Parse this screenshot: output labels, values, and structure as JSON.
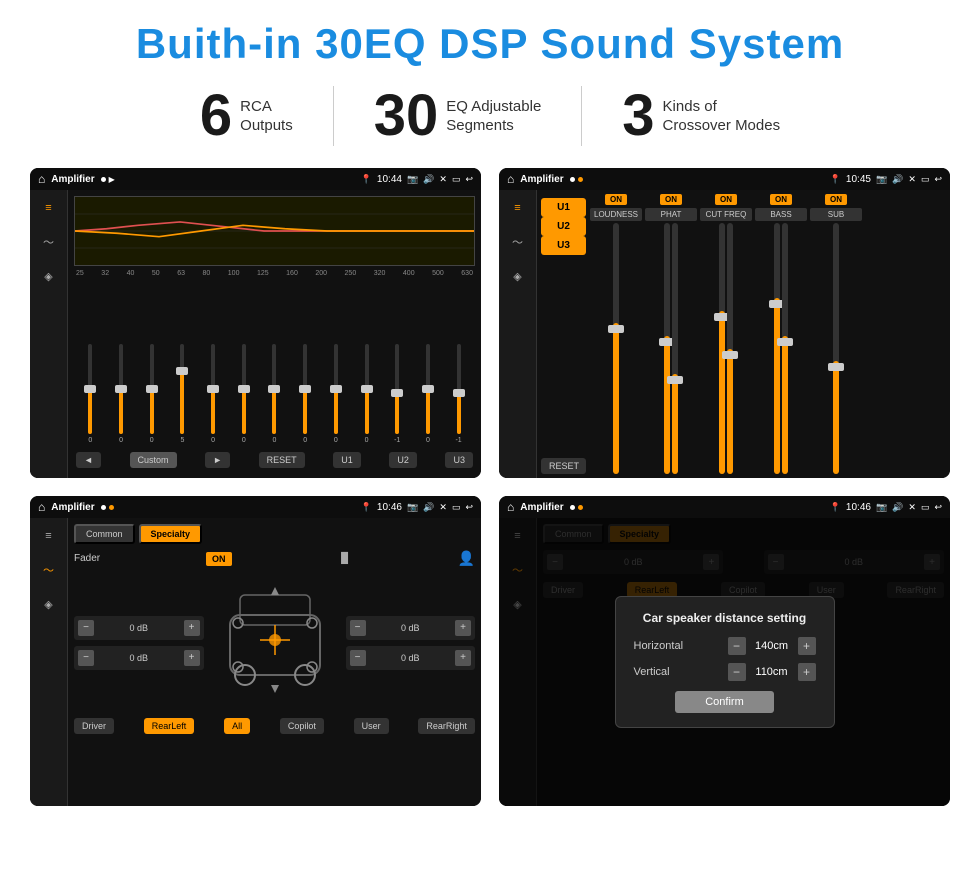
{
  "header": {
    "title": "Buith-in 30EQ DSP Sound System"
  },
  "stats": [
    {
      "number": "6",
      "label": "RCA\nOutputs"
    },
    {
      "number": "30",
      "label": "EQ Adjustable\nSegments"
    },
    {
      "number": "3",
      "label": "Kinds of\nCrossover Modes"
    }
  ],
  "screens": [
    {
      "id": "screen1",
      "statusbar": {
        "app": "Amplifier",
        "time": "10:44"
      },
      "type": "eq",
      "freqs": [
        "25",
        "32",
        "40",
        "50",
        "63",
        "80",
        "100",
        "125",
        "160",
        "200",
        "250",
        "320",
        "400",
        "500",
        "630"
      ],
      "values": [
        "0",
        "0",
        "0",
        "5",
        "0",
        "0",
        "0",
        "0",
        "0",
        "0",
        "-1",
        "0",
        "-1"
      ],
      "preset": "Custom",
      "buttons": [
        "◄",
        "Custom",
        "►",
        "RESET",
        "U1",
        "U2",
        "U3"
      ]
    },
    {
      "id": "screen2",
      "statusbar": {
        "app": "Amplifier",
        "time": "10:45"
      },
      "type": "crossover",
      "u_buttons": [
        "U1",
        "U2",
        "U3"
      ],
      "channels": [
        {
          "label": "LOUDNESS",
          "on": true
        },
        {
          "label": "PHAT",
          "on": true
        },
        {
          "label": "CUT FREQ",
          "on": true
        },
        {
          "label": "BASS",
          "on": true
        },
        {
          "label": "SUB",
          "on": true
        }
      ],
      "reset_label": "RESET"
    },
    {
      "id": "screen3",
      "statusbar": {
        "app": "Amplifier",
        "time": "10:46"
      },
      "type": "fader",
      "tabs": [
        "Common",
        "Specialty"
      ],
      "active_tab": "Specialty",
      "fader_label": "Fader",
      "fader_on": "ON",
      "db_values": [
        "0 dB",
        "0 dB",
        "0 dB",
        "0 dB"
      ],
      "bottom_btns": [
        "Driver",
        "RearLeft",
        "All",
        "Copilot",
        "User",
        "RearRight"
      ]
    },
    {
      "id": "screen4",
      "statusbar": {
        "app": "Amplifier",
        "time": "10:46"
      },
      "type": "fader-dialog",
      "tabs": [
        "Common",
        "Specialty"
      ],
      "dialog": {
        "title": "Car speaker distance setting",
        "rows": [
          {
            "label": "Horizontal",
            "value": "140cm"
          },
          {
            "label": "Vertical",
            "value": "110cm"
          }
        ],
        "confirm_label": "Confirm"
      },
      "db_values": [
        "0 dB",
        "0 dB"
      ],
      "bottom_btns": [
        "Driver",
        "RearLeft",
        "All",
        "Copilot",
        "User",
        "RearRight"
      ]
    }
  ]
}
